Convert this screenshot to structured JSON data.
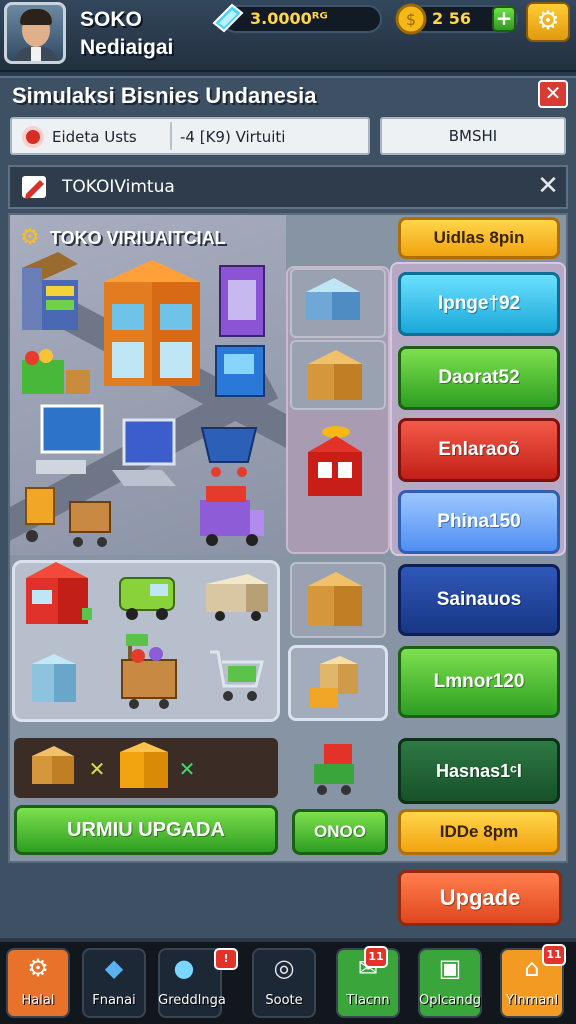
{
  "player": {
    "name": "SOKO Nediaigai",
    "gems": "3.0000ᴿᴳ",
    "gold": "2 56"
  },
  "panel": {
    "title": "Simulaksi Bisnies Undanesia"
  },
  "tabs": {
    "tab1": "Eideta Usts",
    "tab2": "-4 [K9) Virtuiti",
    "tab3": "BMSHI"
  },
  "shop_header": {
    "title": "TOKOIVimtua"
  },
  "shop": {
    "title": "TOKO VIRIUAITCIAL"
  },
  "buttons": {
    "top_orange": "Uidlas 8pin",
    "cyan": "Ipnge†92",
    "green": "Daorat52",
    "red": "Enlaraoõ",
    "blue": "Phina150",
    "navy": "Sainauos",
    "green2": "Lmnor120",
    "darkgreen": "Hasnas1ᶜI",
    "bottom_orange": "IDDe 8pm",
    "upgrade_main": "URMIU UPGADA",
    "small_green": "ONOO",
    "upgrade": "Upgade"
  },
  "nav": [
    {
      "label": "Halal",
      "icon": "gear-icon",
      "color": "#e8722a"
    },
    {
      "label": "Fnanai",
      "icon": "box-icon",
      "color": "#1d2836"
    },
    {
      "label": "Greddlnga",
      "icon": "crystal-icon",
      "color": "#1d2836",
      "badge": ""
    },
    {
      "label": "Soote",
      "icon": "ring-icon",
      "color": "#1d2836"
    },
    {
      "label": "Tlacnn",
      "icon": "map-icon",
      "color": "#3aa53a",
      "badge": "11"
    },
    {
      "label": "Oplcandg",
      "icon": "gift-icon",
      "color": "#3aa53a"
    },
    {
      "label": "Ylnmanl",
      "icon": "shop-icon",
      "color": "#f29a22",
      "badge": "11"
    }
  ]
}
